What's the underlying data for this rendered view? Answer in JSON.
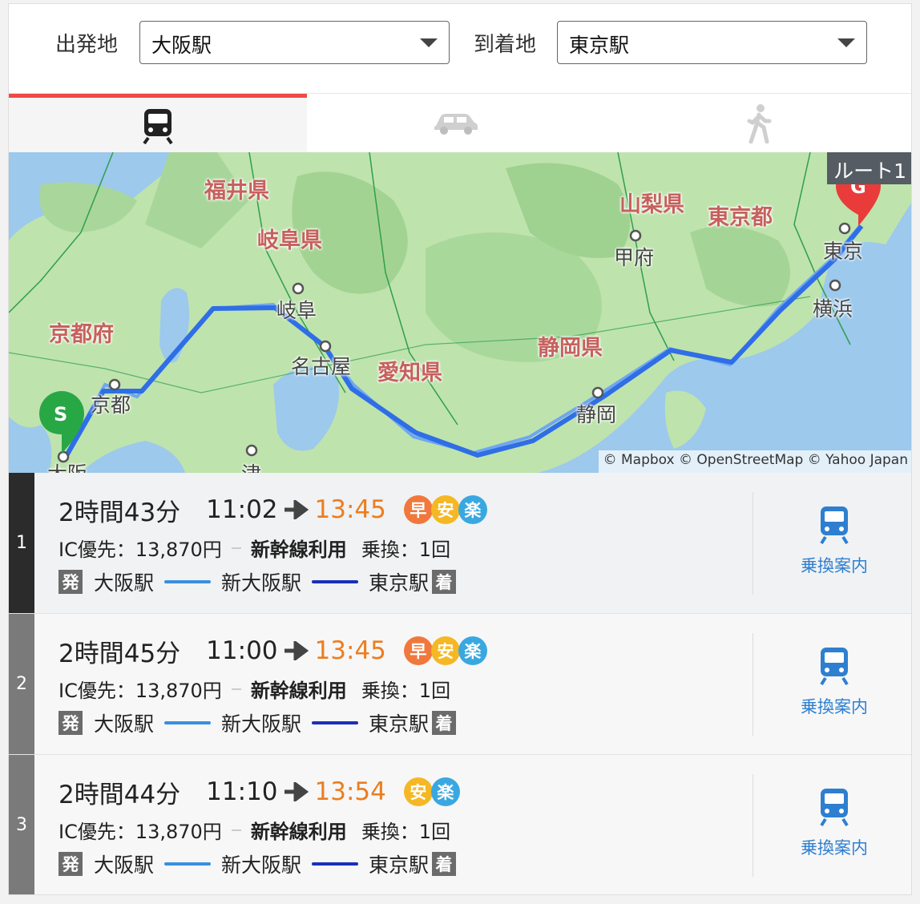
{
  "search": {
    "origin_label": "出発地",
    "origin_value": "大阪駅",
    "destination_label": "到着地",
    "destination_value": "東京駅"
  },
  "tabs": [
    {
      "icon": "train-icon",
      "active": true
    },
    {
      "icon": "car-icon",
      "active": false
    },
    {
      "icon": "walk-icon",
      "active": false
    }
  ],
  "map": {
    "route_badge": "ルート1",
    "attribution": "© Mapbox © OpenStreetMap © Yahoo Japan",
    "start_marker": "S",
    "goal_marker": "G",
    "prefectures": [
      "福井県",
      "岐阜県",
      "京都府",
      "愛知県",
      "静岡県",
      "山梨県",
      "東京都"
    ],
    "cities": [
      "岐阜",
      "名古屋",
      "京都",
      "甲府",
      "東京",
      "横浜",
      "静岡",
      "大阪",
      "津"
    ],
    "route_color": "#2f6ee6"
  },
  "routes": [
    {
      "rank": "1",
      "duration": "2時間43分",
      "depart": "11:02",
      "arrive": "13:45",
      "badges": [
        "早",
        "安",
        "楽"
      ],
      "fare": "IC優先：13,870円",
      "note": "新幹線利用",
      "transfer": "乗換：1回",
      "dep_tag": "発",
      "from": "大阪駅",
      "via": "新大阪駅",
      "to": "東京駅",
      "arr_tag": "着",
      "guide_label": "乗換案内",
      "rank_color": "#2b2b2b"
    },
    {
      "rank": "2",
      "duration": "2時間45分",
      "depart": "11:00",
      "arrive": "13:45",
      "badges": [
        "早",
        "安",
        "楽"
      ],
      "fare": "IC優先：13,870円",
      "note": "新幹線利用",
      "transfer": "乗換：1回",
      "dep_tag": "発",
      "from": "大阪駅",
      "via": "新大阪駅",
      "to": "東京駅",
      "arr_tag": "着",
      "guide_label": "乗換案内",
      "rank_color": "#7a7a7a"
    },
    {
      "rank": "3",
      "duration": "2時間44分",
      "depart": "11:10",
      "arrive": "13:54",
      "badges": [
        "安",
        "楽"
      ],
      "fare": "IC優先：13,870円",
      "note": "新幹線利用",
      "transfer": "乗換：1回",
      "dep_tag": "発",
      "from": "大阪駅",
      "via": "新大阪駅",
      "to": "東京駅",
      "arr_tag": "着",
      "guide_label": "乗換案内",
      "rank_color": "#7a7a7a"
    }
  ],
  "colors": {
    "accent_red": "#ef4a47",
    "arrival_orange": "#ec7d1f",
    "badge_fast": "#f0783c",
    "badge_cheap": "#f5b824",
    "badge_easy": "#3aa8e0",
    "local_line": "#3a8fe0",
    "shinkansen_line": "#1a2fb8",
    "guide_blue": "#2e7fd0"
  }
}
